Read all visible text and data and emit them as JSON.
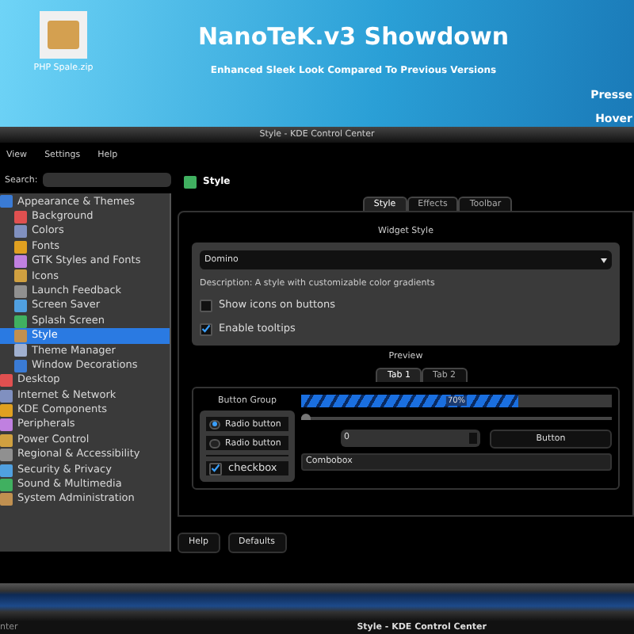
{
  "desktop": {
    "icon_label": "PHP Spale.zip",
    "title": "NanoTeK.v3 Showdown",
    "subtitle": "Enhanced Sleek Look Compared To Previous Versions",
    "side_labels": [
      "Presse",
      "Hover"
    ]
  },
  "window": {
    "title": "Style - KDE Control Center"
  },
  "menu": [
    "View",
    "Settings",
    "Help"
  ],
  "search": {
    "label": "Search:"
  },
  "tree": [
    {
      "label": "Appearance & Themes",
      "selected": false,
      "children": [
        {
          "label": "Background",
          "selected": false
        },
        {
          "label": "Colors",
          "selected": false
        },
        {
          "label": "Fonts",
          "selected": false
        },
        {
          "label": "GTK Styles and Fonts",
          "selected": false
        },
        {
          "label": "Icons",
          "selected": false
        },
        {
          "label": "Launch Feedback",
          "selected": false
        },
        {
          "label": "Screen Saver",
          "selected": false
        },
        {
          "label": "Splash Screen",
          "selected": false
        },
        {
          "label": "Style",
          "selected": true
        },
        {
          "label": "Theme Manager",
          "selected": false
        },
        {
          "label": "Window Decorations",
          "selected": false
        }
      ]
    },
    {
      "label": "Desktop",
      "selected": false
    },
    {
      "label": "Internet & Network",
      "selected": false
    },
    {
      "label": "KDE Components",
      "selected": false
    },
    {
      "label": "Peripherals",
      "selected": false
    },
    {
      "label": "Power Control",
      "selected": false
    },
    {
      "label": "Regional & Accessibility",
      "selected": false
    },
    {
      "label": "Security & Privacy",
      "selected": false
    },
    {
      "label": "Sound & Multimedia",
      "selected": false
    },
    {
      "label": "System Administration",
      "selected": false
    }
  ],
  "module": {
    "title": "Style"
  },
  "tabs": [
    {
      "label": "Style",
      "selected": true
    },
    {
      "label": "Effects",
      "selected": false
    },
    {
      "label": "Toolbar",
      "selected": false
    }
  ],
  "widget_style": {
    "heading": "Widget Style",
    "value": "Domino",
    "description": "Description: A style with customizable color gradients",
    "options": [
      {
        "label": "Show icons on buttons",
        "checked": false
      },
      {
        "label": "Enable tooltips",
        "checked": true
      }
    ]
  },
  "preview": {
    "heading": "Preview",
    "tabs": [
      {
        "label": "Tab 1",
        "selected": true
      },
      {
        "label": "Tab 2",
        "selected": false
      }
    ],
    "group_title": "Button Group",
    "radios": [
      {
        "label": "Radio button",
        "selected": true
      },
      {
        "label": "Radio button",
        "selected": false
      }
    ],
    "checkbox": {
      "label": "checkbox",
      "checked": true
    },
    "progress": {
      "level": 0.7,
      "reading": "70%"
    },
    "slider": {
      "level": 0.0
    },
    "spin_value": "0",
    "button": "Button",
    "combobox": "Combobox"
  },
  "buttons": [
    "Help",
    "Defaults"
  ],
  "taskbar": {
    "items": [
      "nter",
      "Style - KDE Control Center"
    ]
  }
}
